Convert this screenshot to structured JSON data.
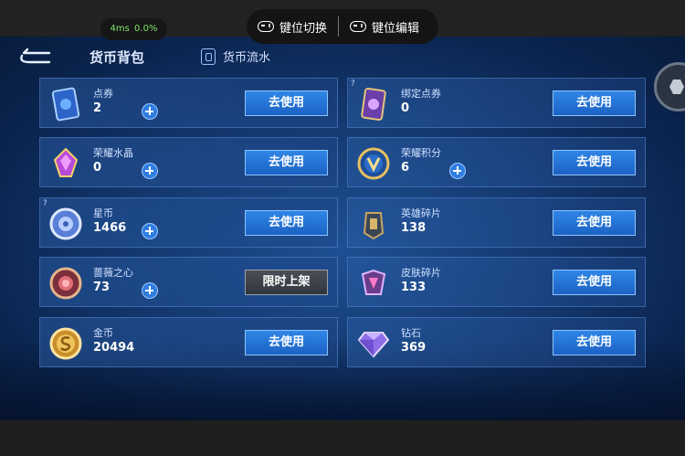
{
  "topbar": {
    "perf": {
      "latency": "4ms",
      "loss": "0.0%"
    },
    "key_switch_label": "键位切换",
    "key_edit_label": "键位编辑"
  },
  "header": {
    "title": "货币背包",
    "flow_tab": "货币流水"
  },
  "currencies": [
    {
      "name": "点券",
      "amount": "2",
      "button": "去使用",
      "icon": "ticket-card-icon",
      "has_plus": true
    },
    {
      "name": "绑定点券",
      "amount": "0",
      "button": "去使用",
      "icon": "bound-ticket-icon",
      "has_plus": false,
      "has_help": true
    },
    {
      "name": "荣耀水晶",
      "amount": "0",
      "button": "去使用",
      "icon": "glory-crystal-icon",
      "has_plus": true
    },
    {
      "name": "荣耀积分",
      "amount": "6",
      "button": "去使用",
      "icon": "glory-points-icon",
      "has_plus": true
    },
    {
      "name": "星币",
      "amount": "1466",
      "button": "去使用",
      "icon": "star-coin-icon",
      "has_plus": true,
      "has_help": true
    },
    {
      "name": "英雄碎片",
      "amount": "138",
      "button": "去使用",
      "icon": "hero-shard-icon",
      "has_plus": false
    },
    {
      "name": "蔷薇之心",
      "amount": "73",
      "button": "限时上架",
      "icon": "rose-heart-icon",
      "has_plus": true,
      "disabled_style": true
    },
    {
      "name": "皮肤碎片",
      "amount": "133",
      "button": "去使用",
      "icon": "skin-shard-icon",
      "has_plus": false
    },
    {
      "name": "金币",
      "amount": "20494",
      "button": "去使用",
      "icon": "gold-coin-icon",
      "has_plus": false
    },
    {
      "name": "钻石",
      "amount": "369",
      "button": "去使用",
      "icon": "diamond-icon",
      "has_plus": false
    }
  ],
  "colors": {
    "button_blue": "#2f86e6",
    "panel_bg": "#143a72",
    "perf_text": "#7fe36a"
  }
}
